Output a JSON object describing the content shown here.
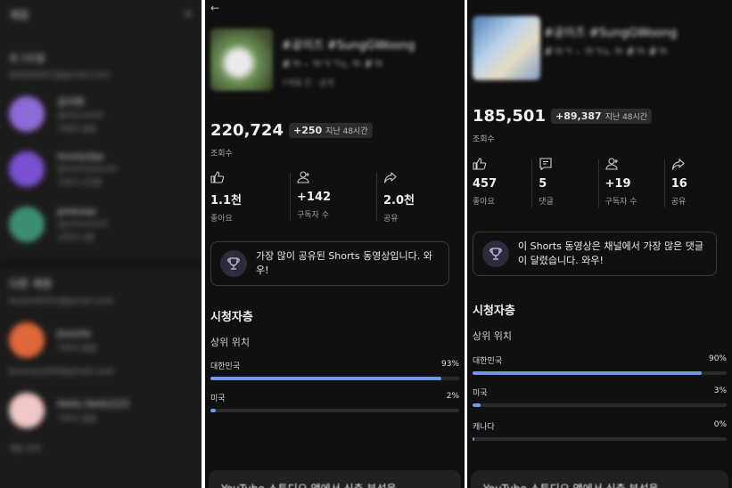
{
  "left": {
    "title": "계정",
    "close": "×",
    "section1": "로그인됨",
    "email1": "bbbbbb01@gmail.com",
    "accounts": [
      {
        "name": "김지현",
        "sub1": "@jihyunkim",
        "sub2": "구독자 없음",
        "color": "#8e6bd8"
      },
      {
        "name": "lovelyday",
        "sub1": "@lovelydaysch",
        "sub2": "구독자 1천명",
        "color": "#7a4fd0"
      },
      {
        "name": "pinkstar",
        "sub1": "@pinkstar22",
        "sub2": "구독자 3명",
        "color": "#3c8f74"
      }
    ],
    "section2": "다른 계정",
    "email2": "heyhello01@gmail.com",
    "accounts2": [
      {
        "name": "Joozzle",
        "sub1": "구독자 없음",
        "color": "#e0673a"
      }
    ],
    "email3": "bunnyyy00@gmail.com",
    "accounts3": [
      {
        "name": "Hello Hello123",
        "sub1": "구독자 없음",
        "color": "#f1c6c6"
      }
    ],
    "footer": "계정 관리"
  },
  "mid": {
    "back": "←",
    "title_line1": "#공이즈 #SungGWoong",
    "title_line2": "#ㄲ - ㄲㄱㄱㄴㄲ #ㄲ",
    "title_line3": "7개월 전 · 공개",
    "views": "220,724",
    "delta": "+250",
    "delta_period": "지난 48시간",
    "views_label": "조회수",
    "stats": [
      {
        "icon": "thumbs-up-icon",
        "value": "1.1천",
        "label": "좋아요"
      },
      {
        "icon": "subscriber-add-icon",
        "value": "+142",
        "label": "구독자 수"
      },
      {
        "icon": "share-icon",
        "value": "2.0천",
        "label": "공유"
      }
    ],
    "insight": "가장 많이 공유된 Shorts 동영상입니다. 와우!",
    "audience_title": "시청자층",
    "geo_title": "상위 위치",
    "geo": [
      {
        "country": "대한민국",
        "pct": "93%",
        "value": 0.93
      },
      {
        "country": "미국",
        "pct": "2%",
        "value": 0.02
      }
    ],
    "studio": "YouTube 스튜디오 앱에서 심층 분석을"
  },
  "right": {
    "title_line1": "#공이즈 #SungGWoong",
    "title_line2": "#ㄲㄱ - ㄲㄱㄴㄲ #ㄲ #ㄲ",
    "title_line3": "",
    "views": "185,501",
    "delta": "+89,387",
    "delta_period": "지난 48시간",
    "views_label": "조회수",
    "stats": [
      {
        "icon": "thumbs-up-icon",
        "value": "457",
        "label": "좋아요"
      },
      {
        "icon": "comment-icon",
        "value": "5",
        "label": "댓글"
      },
      {
        "icon": "subscriber-add-icon",
        "value": "+19",
        "label": "구독자 수"
      },
      {
        "icon": "share-icon",
        "value": "16",
        "label": "공유"
      }
    ],
    "insight": "이 Shorts 동영상은 채널에서 가장 많은 댓글이 달렸습니다. 와우!",
    "audience_title": "시청자층",
    "geo_title": "상위 위치",
    "geo": [
      {
        "country": "대한민국",
        "pct": "90%",
        "value": 0.9
      },
      {
        "country": "미국",
        "pct": "3%",
        "value": 0.03
      },
      {
        "country": "캐나다",
        "pct": "0%",
        "value": 0.004
      }
    ],
    "studio": "YouTube 스튜디오 앱에서 심층 분석을"
  },
  "colors": {
    "bar": "#6e9ae8",
    "background": "#101010"
  }
}
